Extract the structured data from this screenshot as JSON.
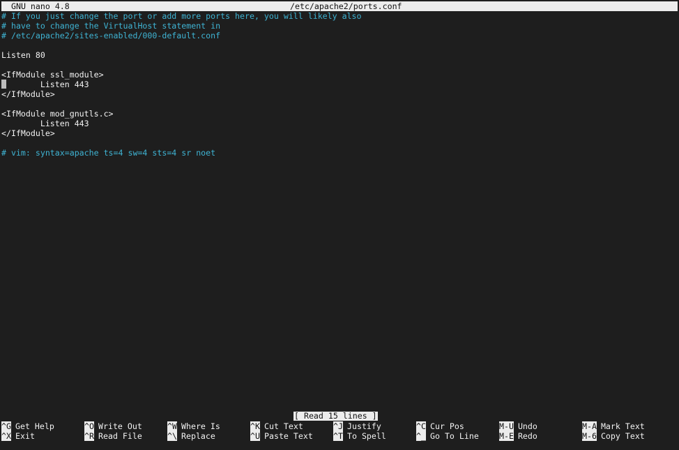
{
  "title_bar": {
    "app": "GNU nano 4.8",
    "file": "/etc/apache2/ports.conf"
  },
  "editor": {
    "lines": [
      {
        "text": "# If you just change the port or add more ports here, you will likely also",
        "type": "comment"
      },
      {
        "text": "# have to change the VirtualHost statement in",
        "type": "comment"
      },
      {
        "text": "# /etc/apache2/sites-enabled/000-default.conf",
        "type": "comment"
      },
      {
        "text": "",
        "type": "text"
      },
      {
        "text": "Listen 80",
        "type": "text"
      },
      {
        "text": "",
        "type": "text"
      },
      {
        "text": "<IfModule ssl_module>",
        "type": "text"
      },
      {
        "text": "        Listen 443",
        "type": "text",
        "cursor": true
      },
      {
        "text": "</IfModule>",
        "type": "text"
      },
      {
        "text": "",
        "type": "text"
      },
      {
        "text": "<IfModule mod_gnutls.c>",
        "type": "text"
      },
      {
        "text": "        Listen 443",
        "type": "text"
      },
      {
        "text": "</IfModule>",
        "type": "text"
      },
      {
        "text": "",
        "type": "text"
      },
      {
        "text": "# vim: syntax=apache ts=4 sw=4 sts=4 sr noet",
        "type": "comment"
      }
    ]
  },
  "status_message": "[ Read 15 lines ]",
  "shortcuts": {
    "row1": [
      {
        "key": "^G",
        "label": "Get Help"
      },
      {
        "key": "^O",
        "label": "Write Out"
      },
      {
        "key": "^W",
        "label": "Where Is"
      },
      {
        "key": "^K",
        "label": "Cut Text"
      },
      {
        "key": "^J",
        "label": "Justify"
      },
      {
        "key": "^C",
        "label": "Cur Pos"
      },
      {
        "key": "M-U",
        "label": "Undo"
      },
      {
        "key": "M-A",
        "label": "Mark Text"
      }
    ],
    "row2": [
      {
        "key": "^X",
        "label": "Exit"
      },
      {
        "key": "^R",
        "label": "Read File"
      },
      {
        "key": "^\\",
        "label": "Replace"
      },
      {
        "key": "^U",
        "label": "Paste Text"
      },
      {
        "key": "^T",
        "label": "To Spell"
      },
      {
        "key": "^_",
        "label": "Go To Line"
      },
      {
        "key": "M-E",
        "label": "Redo"
      },
      {
        "key": "M-6",
        "label": "Copy Text"
      }
    ]
  },
  "colors": {
    "background": "#1e1e1e",
    "comment": "#3fb4d4",
    "inverse_bg": "#ececec"
  }
}
